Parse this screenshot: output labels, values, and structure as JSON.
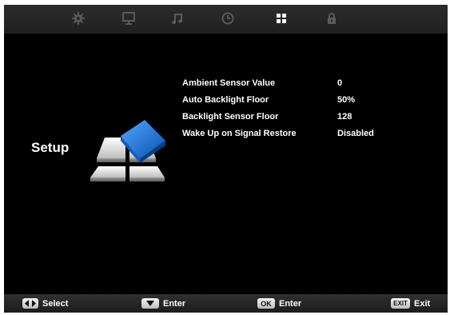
{
  "tabs": [
    {
      "icon": "gear-icon"
    },
    {
      "icon": "monitor-icon"
    },
    {
      "icon": "music-note-icon"
    },
    {
      "icon": "clock-icon"
    },
    {
      "icon": "grid-icon",
      "active": true
    },
    {
      "icon": "lock-icon"
    }
  ],
  "section": {
    "title": "Setup",
    "icon": "setup-icon"
  },
  "menu": {
    "items": [
      {
        "label": "Ambient Sensor Value",
        "value": "0"
      },
      {
        "label": "Auto Backlight Floor",
        "value": "50%"
      },
      {
        "label": "Backlight Sensor Floor",
        "value": "128"
      },
      {
        "label": "Wake Up on Signal Restore",
        "value": "Disabled"
      }
    ]
  },
  "hints": {
    "select": "Select",
    "enter1": "Enter",
    "ok_key": "OK",
    "enter2": "Enter",
    "exit_key": "EXIT",
    "exit": "Exit"
  },
  "colors": {
    "background": "#000000",
    "bar": "#262626",
    "icon_dim": "#5a5a5a",
    "icon_active": "#ffffff",
    "accent_blue": "#1f6fd0"
  }
}
